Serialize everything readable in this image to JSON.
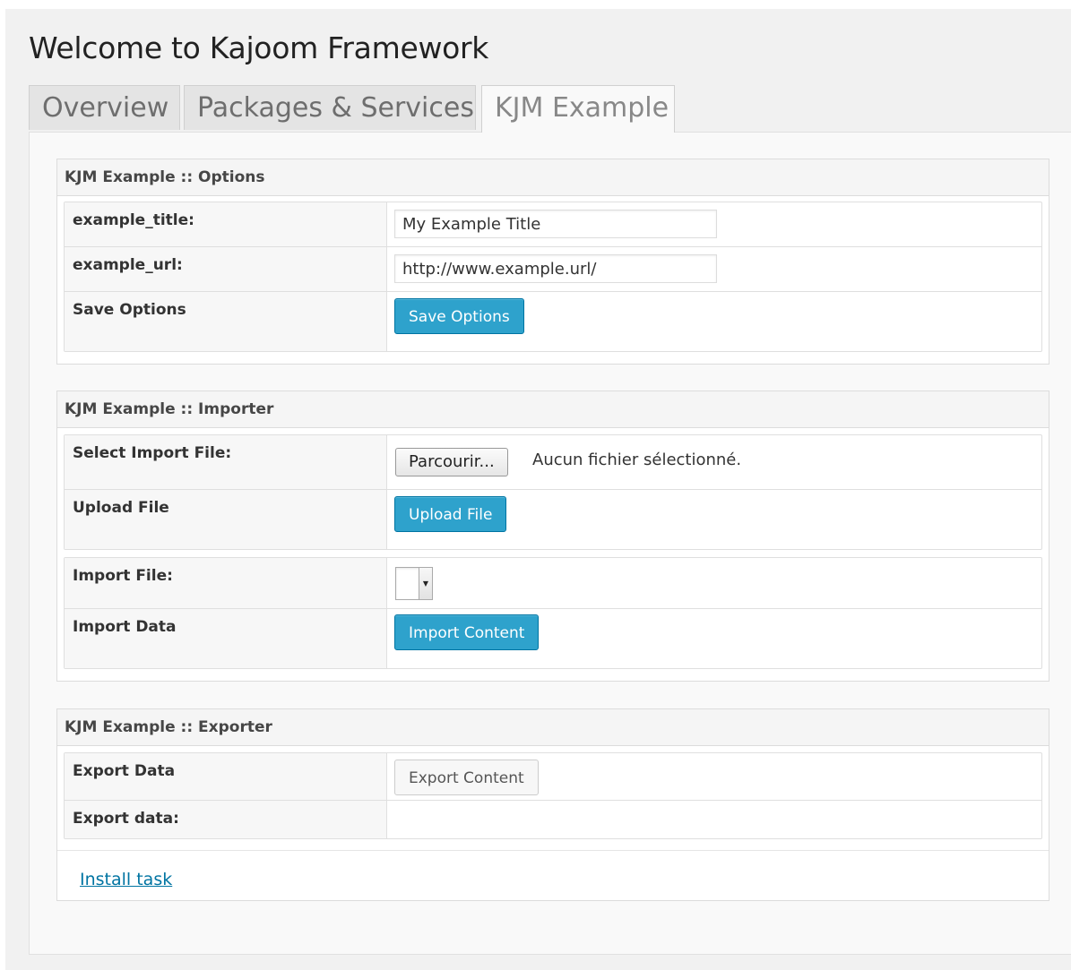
{
  "page": {
    "title": "Welcome to Kajoom Framework"
  },
  "tabs": [
    {
      "label": "Overview"
    },
    {
      "label": "Packages & Services"
    },
    {
      "label": "KJM Example"
    }
  ],
  "options_box": {
    "title": "KJM Example :: Options",
    "rows": [
      {
        "label": "example_title:",
        "value": "My Example Title"
      },
      {
        "label": "example_url:",
        "value": "http://www.example.url/"
      },
      {
        "label": "Save Options",
        "button": "Save Options"
      }
    ]
  },
  "importer_box": {
    "title": "KJM Example :: Importer",
    "select_file_label": "Select Import File:",
    "browse_button": "Parcourir...",
    "file_status": "Aucun fichier sélectionné.",
    "upload_label": "Upload File",
    "upload_button": "Upload File",
    "import_file_label": "Import File:",
    "import_data_label": "Import Data",
    "import_button": "Import Content"
  },
  "exporter_box": {
    "title": "KJM Example :: Exporter",
    "export_data_label": "Export Data",
    "export_button": "Export Content",
    "export_data_field_label": "Export data:"
  },
  "install_link": "Install task",
  "colors": {
    "primary_button": "#2ea2cc",
    "link": "#0074a2"
  }
}
